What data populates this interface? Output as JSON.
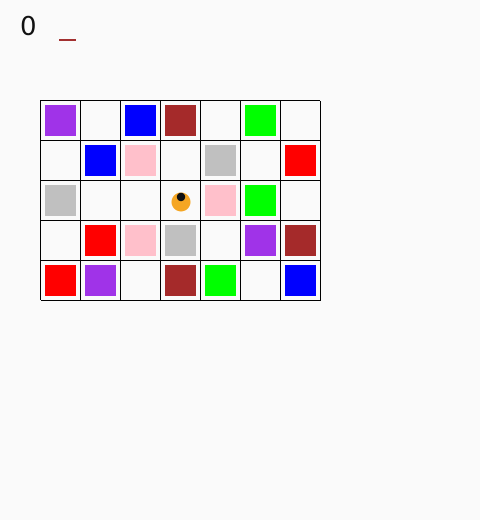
{
  "hud": {
    "score": "0"
  },
  "colors": {
    "purple": "#a033e8",
    "blue": "#0000ff",
    "brown": "#a52a2a",
    "green": "#00ff00",
    "pink": "#ffc0cb",
    "gray": "#c0c0c0",
    "red": "#ff0000",
    "player_body": "#f5a623",
    "player_eye": "#111111",
    "cursor_mark": "#a23030"
  },
  "board": {
    "rows": 5,
    "cols": 7,
    "cells": [
      [
        "purple",
        null,
        "blue",
        "brown",
        null,
        "green",
        null
      ],
      [
        null,
        "blue",
        "pink",
        null,
        "gray",
        null,
        "red"
      ],
      [
        "gray",
        null,
        null,
        "player",
        "pink",
        "green",
        null
      ],
      [
        null,
        "red",
        "pink",
        "gray",
        null,
        "purple",
        "brown"
      ],
      [
        "red",
        "purple",
        null,
        "brown",
        "green",
        null,
        "blue"
      ]
    ]
  },
  "player": {
    "name": "player-icon",
    "row": 2,
    "col": 3
  }
}
